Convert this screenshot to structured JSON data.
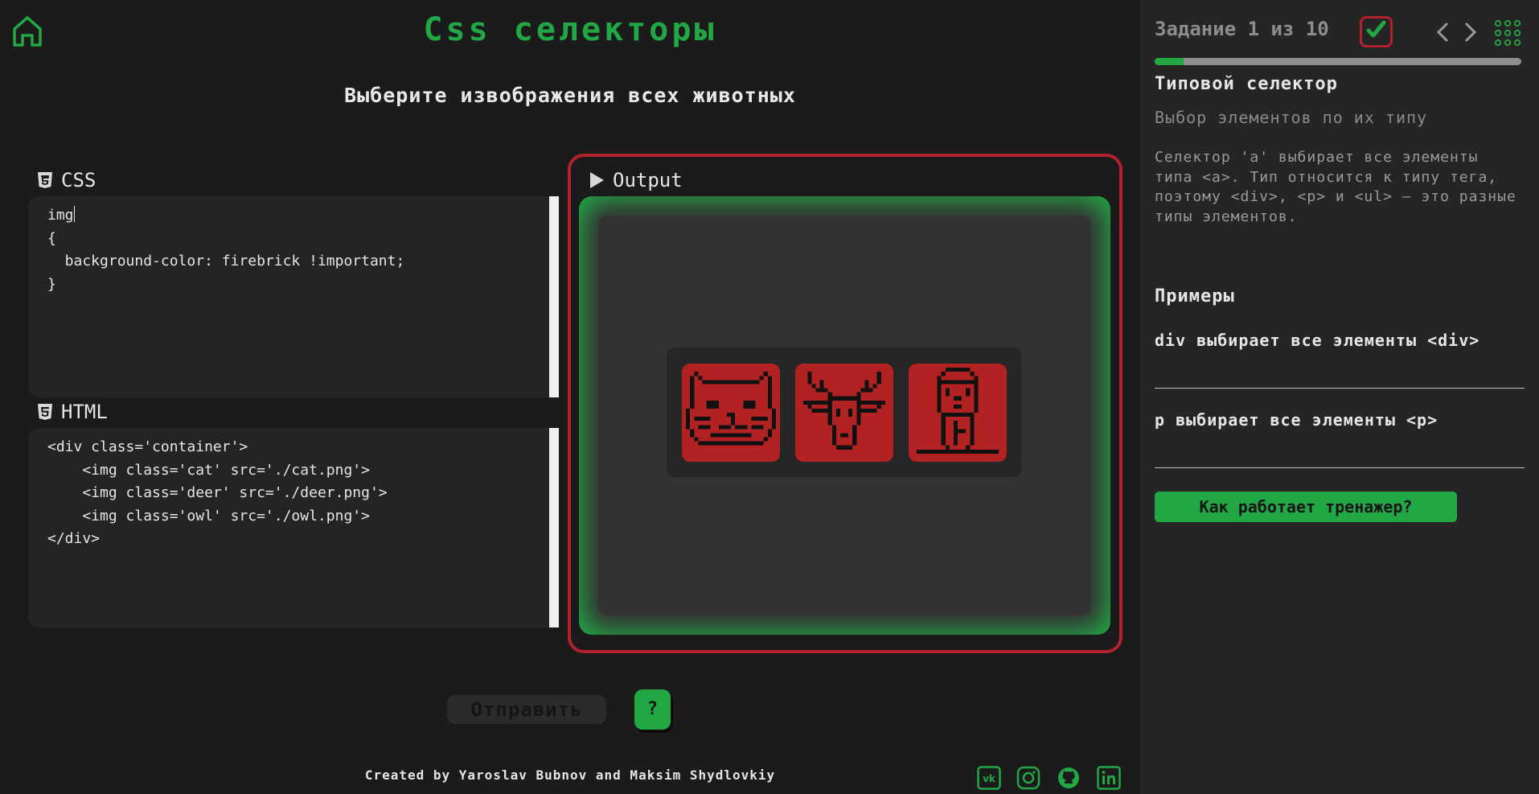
{
  "header": {
    "title": "Css селекторы",
    "instruction": "Выберите извображения всех животных"
  },
  "css_panel": {
    "label": "CSS",
    "lines": [
      "img",
      "{",
      "  background-color: firebrick !important;",
      "}"
    ]
  },
  "html_panel": {
    "label": "HTML",
    "lines": [
      "<div class='container'>",
      "    <img class='cat' src='./cat.png'>",
      "    <img class='deer' src='./deer.png'>",
      "    <img class='owl' src='./owl.png'>",
      "</div>"
    ]
  },
  "output_panel": {
    "label": "Output",
    "images": [
      {
        "name": "cat",
        "icon": "cat-pixel-icon"
      },
      {
        "name": "deer",
        "icon": "deer-pixel-icon"
      },
      {
        "name": "owl",
        "icon": "owl-pixel-icon"
      }
    ],
    "image_bg": "#b22222",
    "stage_color": "#22a745",
    "frame_color": "#b2222d"
  },
  "actions": {
    "submit_label": "Отправить",
    "help_label": "?"
  },
  "footer": {
    "credits": "Created by Yaroslav Bubnov and Maksim Shydlovkiy",
    "social_icons": [
      "vk-icon",
      "instagram-icon",
      "github-icon",
      "linkedin-icon"
    ]
  },
  "sidebar": {
    "task_counter": "Задание 1 из 10",
    "completed_icon": "checkmark-icon",
    "progress_fraction": 0.08,
    "level_title": "Типовой селектор",
    "level_subtitle": "Выбор элементов по их типу",
    "description": "Селектор 'a' выбирает все элементы типа <a>. Тип относится к типу тега, поэтому <div>, <p> и <ul> — это разные типы элементов.",
    "examples_heading": "Примеры",
    "examples": [
      "div выбирает все элементы <div>",
      "p выбирает все элементы <p>"
    ],
    "how_it_works_label": "Как работает тренажер?"
  },
  "colors": {
    "accent": "#22a745",
    "danger": "#b2222d",
    "background": "#1b1b1b",
    "sidebar": "#252525"
  }
}
